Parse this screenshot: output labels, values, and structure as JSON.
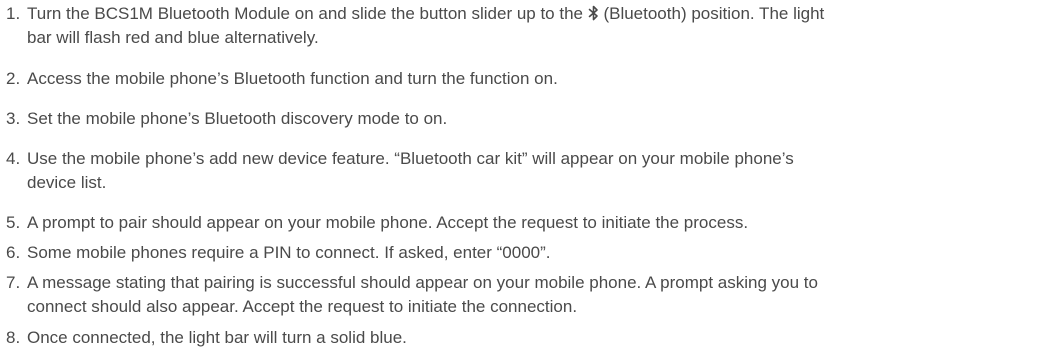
{
  "steps": [
    {
      "number": "1.",
      "text_before_icon": "Turn the BCS1M Bluetooth Module on and slide the button slider up to the ",
      "icon": "bluetooth-icon",
      "text_after_icon": " (Bluetooth) position. The light\nbar will flash red and blue alternatively."
    },
    {
      "number": "2.",
      "text": "Access the mobile phone’s Bluetooth function and turn the function on."
    },
    {
      "number": "3.",
      "text": "Set the mobile phone’s Bluetooth discovery mode to on."
    },
    {
      "number": "4.",
      "text": "Use the mobile phone’s add new device feature. “Bluetooth car kit” will appear on your mobile phone’s\ndevice list."
    },
    {
      "number": "5.",
      "text": "A prompt to pair should appear on your mobile phone. Accept the request to initiate the process."
    },
    {
      "number": "6.",
      "text": "Some mobile phones require a PIN to connect. If asked, enter “0000”."
    },
    {
      "number": "7.",
      "text": "A message stating that pairing is successful should appear on your mobile phone. A prompt asking you to\nconnect should also appear. Accept the request to initiate the connection."
    },
    {
      "number": "8.",
      "text": "Once connected, the light bar will turn a solid blue."
    }
  ],
  "colors": {
    "text": "#4a4a4a",
    "background": "#ffffff"
  }
}
